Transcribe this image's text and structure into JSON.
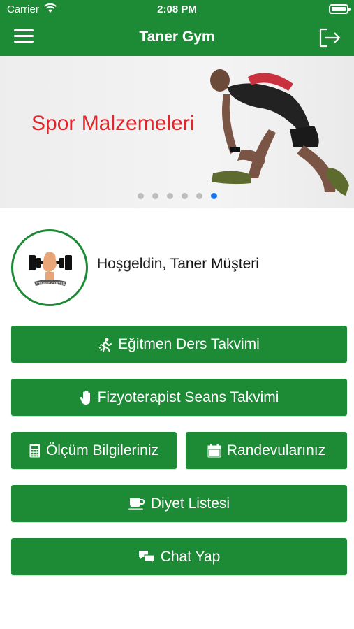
{
  "status_bar": {
    "carrier": "Carrier",
    "time": "2:08 PM"
  },
  "nav": {
    "title": "Taner Gym"
  },
  "banner": {
    "text": "Spor Malzemeleri",
    "dot_count": 6,
    "active_dot": 6
  },
  "profile": {
    "greeting": "Hoşgeldin,",
    "name": "Taner Müşteri"
  },
  "buttons": {
    "trainer_schedule": "Eğitmen Ders Takvimi",
    "physio_schedule": "Fizyoterapist Seans Takvimi",
    "measurements": "Ölçüm Bilgileriniz",
    "appointments": "Randevularınız",
    "diet": "Diyet Listesi",
    "chat": "Chat Yap"
  },
  "colors": {
    "primary": "#1d8a35",
    "banner_text": "#e0262a",
    "active_dot": "#1a73e8"
  },
  "icons": {
    "menu": "hamburger-icon",
    "logout": "logout-icon",
    "trainer": "trainer-icon",
    "physio": "hand-icon",
    "measure": "calculator-icon",
    "appoint": "calendar-icon",
    "diet": "coffee-cup-icon",
    "chat": "chat-bubbles-icon"
  }
}
